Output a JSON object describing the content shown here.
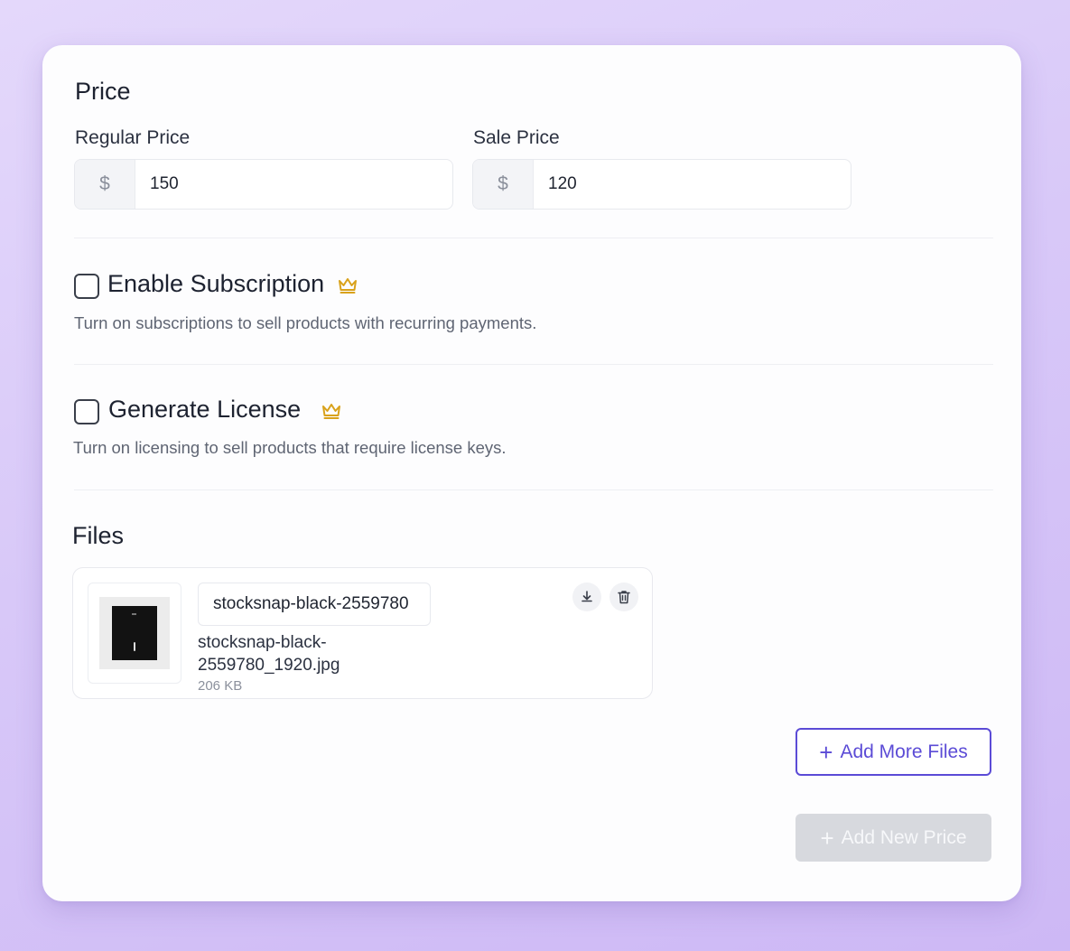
{
  "price_section": {
    "title": "Price",
    "regular": {
      "label": "Regular Price",
      "prefix": "$",
      "value": "150"
    },
    "sale": {
      "label": "Sale Price",
      "prefix": "$",
      "value": "120"
    }
  },
  "subscription": {
    "title": "Enable Subscription",
    "description": "Turn on subscriptions to sell products with recurring payments.",
    "checked": false,
    "badge_icon": "crown-icon"
  },
  "license": {
    "title": "Generate License",
    "description": "Turn on licensing to sell products that require license keys.",
    "checked": false,
    "badge_icon": "crown-icon"
  },
  "files_section": {
    "title": "Files",
    "files": [
      {
        "display_name": "stocksnap-black-2559780",
        "file_name": "stocksnap-black-2559780_1920.jpg",
        "size": "206 KB"
      }
    ]
  },
  "buttons": {
    "add_more_files": "Add More Files",
    "add_new_price": "Add New Price",
    "plus_symbol": "+"
  },
  "colors": {
    "accent": "#5b4bd6",
    "crown": "#d9a21b",
    "disabled_button": "#d7d9de"
  }
}
